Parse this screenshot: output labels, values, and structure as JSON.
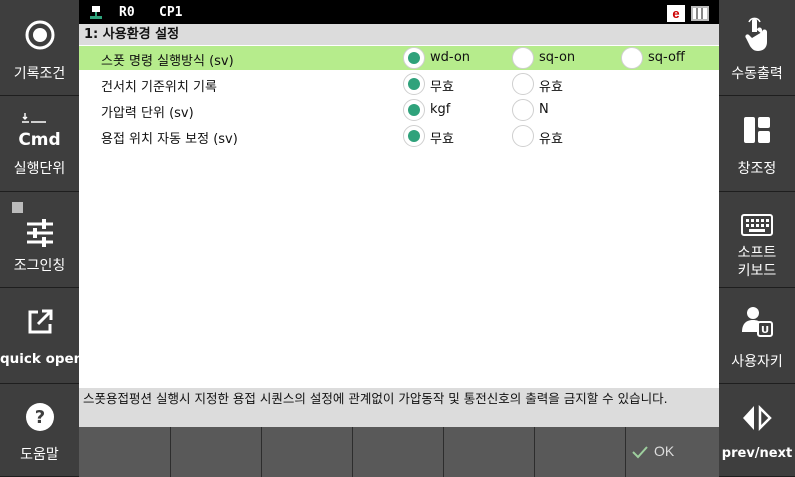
{
  "topbar": {
    "robot": "R0",
    "program": "CP1",
    "e_badge": "e"
  },
  "left_sidebar": [
    {
      "label": "기록조건",
      "icon": "record-circle-icon"
    },
    {
      "label": "실행단위",
      "icon": "cmd-icon",
      "icon_text": "Cmd"
    },
    {
      "label": "조그인칭",
      "icon": "sliders-icon"
    },
    {
      "label": "quick open",
      "icon": "external-link-icon"
    },
    {
      "label": "도움말",
      "icon": "help-icon"
    }
  ],
  "right_sidebar": [
    {
      "label": "수동출력",
      "icon": "touch-hand-icon"
    },
    {
      "label": "창조정",
      "icon": "window-layout-icon"
    },
    {
      "label": "소프트\n키보드",
      "label_line1": "소프트",
      "label_line2": "키보드",
      "icon": "keyboard-icon"
    },
    {
      "label": "사용자키",
      "icon": "user-key-icon"
    },
    {
      "label": "prev/next",
      "icon": "prev-next-icon"
    }
  ],
  "panel": {
    "title": "1: 사용환경 설정",
    "rows": [
      {
        "label": "스폿 명령 실행방식 (sv)",
        "options": [
          "wd-on",
          "sq-on",
          "sq-off"
        ],
        "selected": 0
      },
      {
        "label": "건서치 기준위치 기록",
        "options": [
          "무효",
          "유효"
        ],
        "selected": 0
      },
      {
        "label": "가압력 단위 (sv)",
        "options": [
          "kgf",
          "N"
        ],
        "selected": 0
      },
      {
        "label": "용접 위치 자동 보정 (sv)",
        "options": [
          "무효",
          "유효"
        ],
        "selected": 0
      }
    ]
  },
  "status_text": "스폿용접펑션 실행시 지정한 용접 시퀀스의 설정에 관계없이 가압동작 및 통전신호의 출력을 금지할 수 있습니다.",
  "bottom_bar": {
    "ok_label": "OK"
  },
  "colors": {
    "highlight": "#b6ec8c",
    "radio_on": "#2fa27b",
    "e_badge": "#cc0000"
  }
}
